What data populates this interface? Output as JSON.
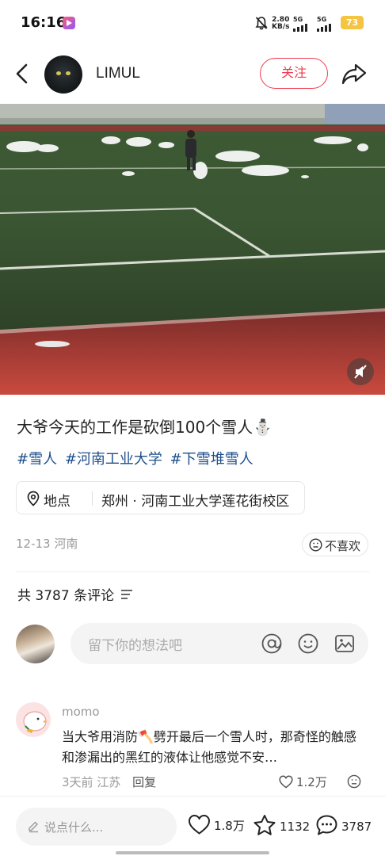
{
  "status_bar": {
    "time": "16:16",
    "speed_value": "2.80",
    "speed_unit": "KB/s",
    "sim1_label": "5G",
    "sim2_label": "5G",
    "battery": "73"
  },
  "header": {
    "username": "LIMUL",
    "follow_label": "关注"
  },
  "post": {
    "title": "大爷今天的工作是砍倒100个雪人⛄",
    "tags": [
      "#雪人",
      "#河南工业大学",
      "#下雪堆雪人"
    ],
    "location_label": "地点",
    "location_value": "郑州 · 河南工业大学莲花街校区",
    "date": "12-13 河南",
    "dislike_label": "不喜欢"
  },
  "comments": {
    "count_label": "共 3787 条评论",
    "input_placeholder": "留下你的想法吧",
    "items": [
      {
        "name": "momo",
        "text": "当大爷用消防🪓劈开最后一个雪人时，那奇怪的触感和渗漏出的黑红的液体让他感觉不安…",
        "time_loc": "3天前 江苏",
        "reply_label": "回复",
        "likes": "1.2万"
      }
    ]
  },
  "bottom_bar": {
    "say_placeholder": "说点什么...",
    "likes": "1.8万",
    "stars": "1132",
    "comments": "3787"
  },
  "colors": {
    "accent_red": "#ef3b4f",
    "tag_blue": "#1e4f8c",
    "battery_yellow": "#f6c443"
  }
}
